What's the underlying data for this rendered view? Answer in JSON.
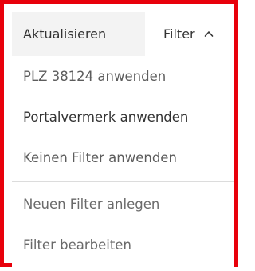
{
  "header": {
    "refresh_label": "Aktualisieren",
    "filter_label": "Filter",
    "filter_icon": "chevron-up-icon"
  },
  "menu": {
    "items": [
      {
        "label": "PLZ 38124 anwenden"
      },
      {
        "label": "Portalvermerk anwenden"
      },
      {
        "label": "Keinen Filter anwenden"
      }
    ],
    "actions": [
      {
        "label": "Neuen Filter anlegen"
      },
      {
        "label": "Filter bearbeiten"
      }
    ]
  },
  "colors": {
    "frame_border": "#e8000b",
    "header_bg": "#f3f3f3",
    "divider": "#dcdcdc"
  }
}
